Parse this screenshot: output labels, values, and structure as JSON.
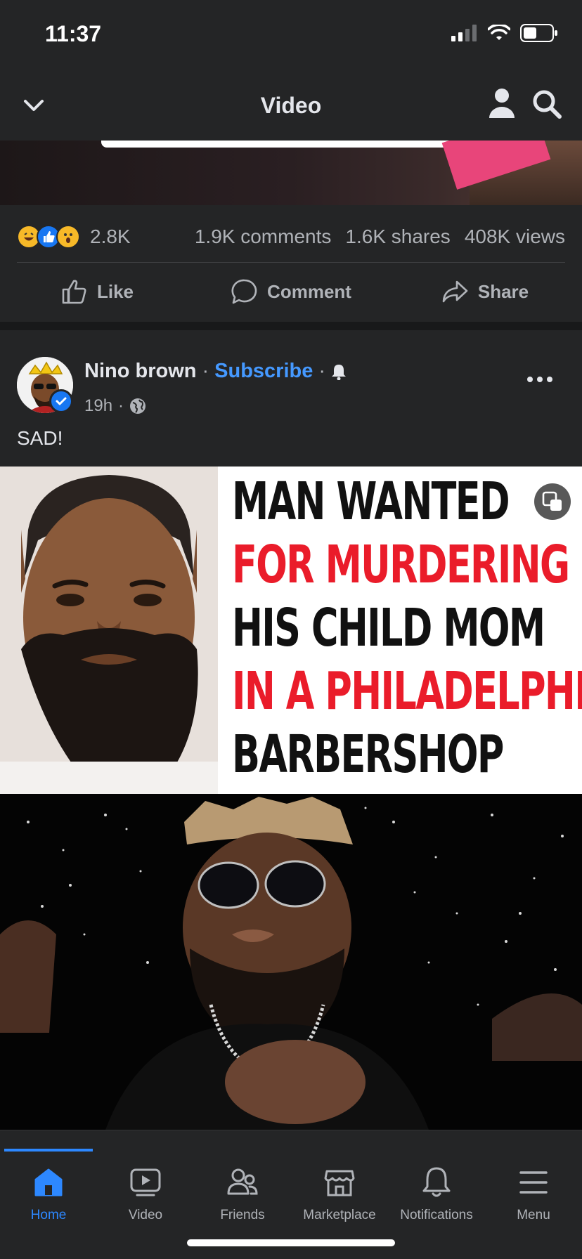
{
  "status_bar": {
    "time": "11:37"
  },
  "header": {
    "title": "Video"
  },
  "stats": {
    "reactions_count": "2.8K",
    "comments": "1.9K comments",
    "shares": "1.6K shares",
    "views": "408K views"
  },
  "actions": {
    "like": "Like",
    "comment": "Comment",
    "share": "Share"
  },
  "post": {
    "author": "Nino brown",
    "subscribe": "Subscribe",
    "time": "19h",
    "caption": "SAD!",
    "headline": [
      {
        "text": "MAN WANTED",
        "color": "#111111"
      },
      {
        "text": "FOR MURDERING",
        "color": "#ea1c2a"
      },
      {
        "text": "HIS CHILD MOM",
        "color": "#111111"
      },
      {
        "text": "IN A PHILADELPHIA",
        "color": "#ea1c2a"
      },
      {
        "text": "BARBERSHOP",
        "color": "#111111"
      }
    ]
  },
  "tabbar": {
    "home": "Home",
    "video": "Video",
    "friends": "Friends",
    "marketplace": "Marketplace",
    "notifications": "Notifications",
    "menu": "Menu"
  },
  "colors": {
    "accent": "#2d88ff",
    "subscribe": "#4599ff",
    "background": "#242526"
  }
}
